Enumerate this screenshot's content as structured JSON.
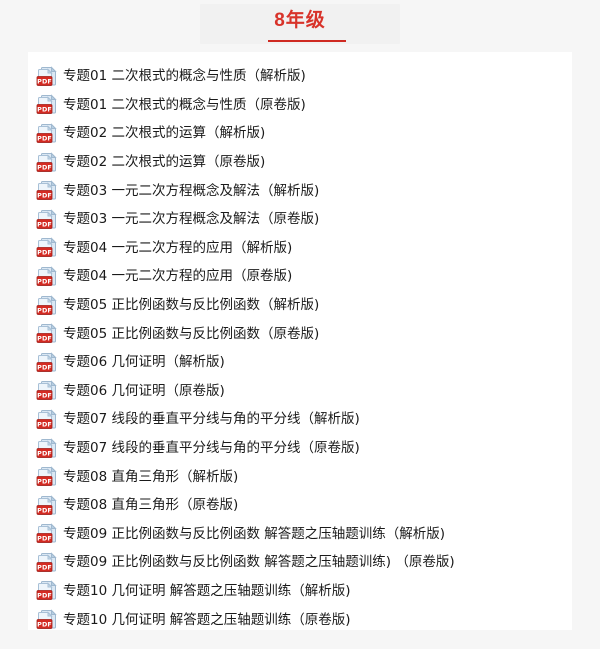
{
  "header": {
    "title": "8年级",
    "title_color": "#d8332a",
    "underline_color": "#cf2a22"
  },
  "icons": {
    "file_icon_name": "pdf-file-icon",
    "badge_text": "PDF",
    "badge_color": "#d42a22",
    "sheet_color": "#ccdded"
  },
  "list": {
    "items": [
      {
        "icon": "pdf-file-icon",
        "label": "专题01 二次根式的概念与性质（解析版)"
      },
      {
        "icon": "pdf-file-icon",
        "label": "专题01 二次根式的概念与性质（原卷版)"
      },
      {
        "icon": "pdf-file-icon",
        "label": "专题02 二次根式的运算（解析版)"
      },
      {
        "icon": "pdf-file-icon",
        "label": "专题02 二次根式的运算（原卷版)"
      },
      {
        "icon": "pdf-file-icon",
        "label": "专题03 一元二次方程概念及解法（解析版)"
      },
      {
        "icon": "pdf-file-icon",
        "label": "专题03 一元二次方程概念及解法（原卷版)"
      },
      {
        "icon": "pdf-file-icon",
        "label": "专题04 一元二次方程的应用（解析版)"
      },
      {
        "icon": "pdf-file-icon",
        "label": "专题04 一元二次方程的应用（原卷版)"
      },
      {
        "icon": "pdf-file-icon",
        "label": "专题05 正比例函数与反比例函数（解析版)"
      },
      {
        "icon": "pdf-file-icon",
        "label": "专题05 正比例函数与反比例函数（原卷版)"
      },
      {
        "icon": "pdf-file-icon",
        "label": "专题06 几何证明（解析版)"
      },
      {
        "icon": "pdf-file-icon",
        "label": "专题06 几何证明（原卷版)"
      },
      {
        "icon": "pdf-file-icon",
        "label": "专题07 线段的垂直平分线与角的平分线（解析版)"
      },
      {
        "icon": "pdf-file-icon",
        "label": "专题07 线段的垂直平分线与角的平分线（原卷版)"
      },
      {
        "icon": "pdf-file-icon",
        "label": "专题08 直角三角形（解析版)"
      },
      {
        "icon": "pdf-file-icon",
        "label": "专题08 直角三角形（原卷版)"
      },
      {
        "icon": "pdf-file-icon",
        "label": "专题09  正比例函数与反比例函数  解答题之压轴题训练（解析版)"
      },
      {
        "icon": "pdf-file-icon",
        "label": "专题09  正比例函数与反比例函数  解答题之压轴题训练)  （原卷版)"
      },
      {
        "icon": "pdf-file-icon",
        "label": "专题10 几何证明 解答题之压轴题训练（解析版)"
      },
      {
        "icon": "pdf-file-icon",
        "label": "专题10 几何证明 解答题之压轴题训练（原卷版)"
      }
    ]
  }
}
